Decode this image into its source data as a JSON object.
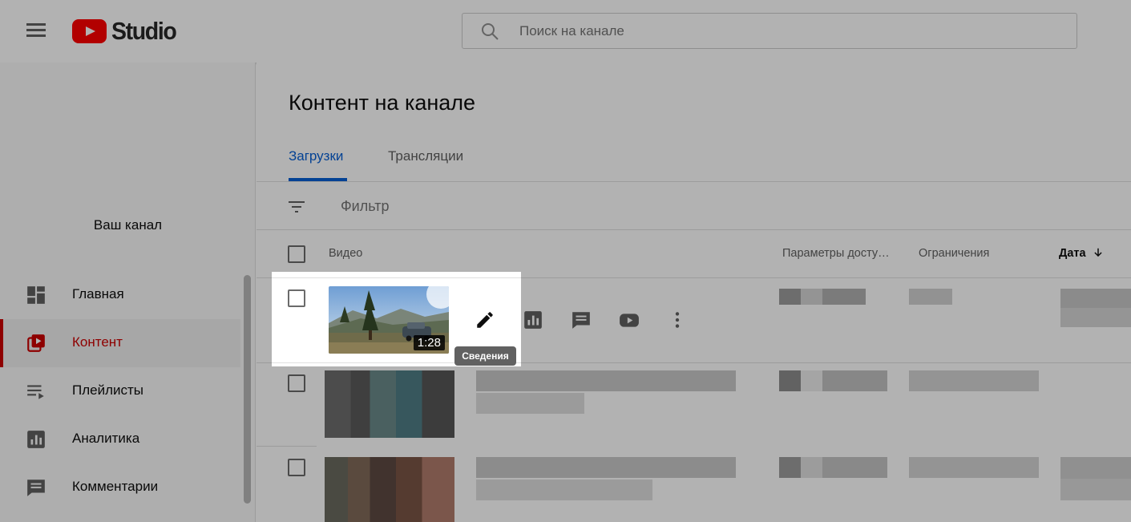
{
  "app": {
    "logo_text": "Studio",
    "brand_color": "#ff0000"
  },
  "header": {
    "search_placeholder": "Поиск на канале"
  },
  "sidebar": {
    "channel_name": "Ваш канал",
    "items": [
      {
        "label": "Главная",
        "icon": "dashboard-icon"
      },
      {
        "label": "Контент",
        "icon": "content-icon",
        "active": true
      },
      {
        "label": "Плейлисты",
        "icon": "playlist-icon"
      },
      {
        "label": "Аналитика",
        "icon": "analytics-icon"
      },
      {
        "label": "Комментарии",
        "icon": "comments-icon"
      }
    ]
  },
  "main": {
    "title": "Контент на канале",
    "tabs": [
      {
        "label": "Загрузки",
        "active": true
      },
      {
        "label": "Трансляции"
      }
    ],
    "filter_label": "Фильтр",
    "columns": {
      "video": "Видео",
      "visibility": "Параметры досту…",
      "restrictions": "Ограничения",
      "date": "Дата"
    },
    "highlighted_row": {
      "duration": "1:28",
      "tooltip": "Сведения",
      "actions": [
        "edit-icon",
        "analytics-icon",
        "comments-icon",
        "youtube-icon",
        "more-vert-icon"
      ]
    }
  },
  "colors": {
    "accent": "#065fd4",
    "active_nav": "#cc0000"
  }
}
